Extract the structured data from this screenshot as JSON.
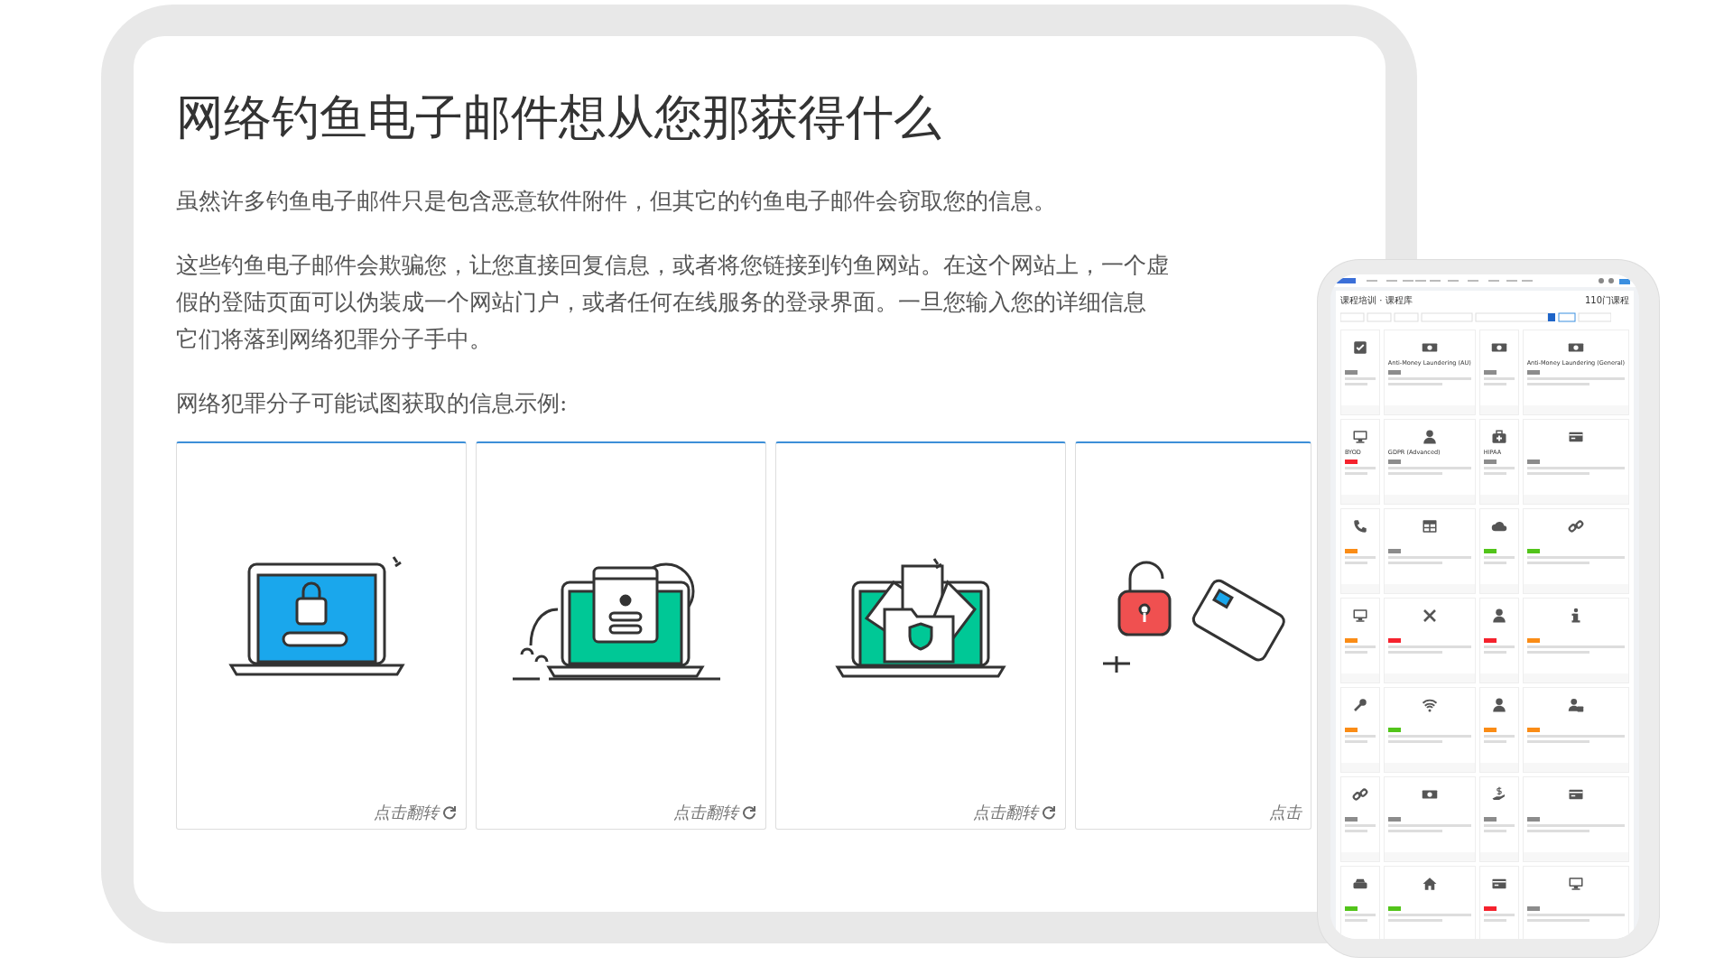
{
  "article": {
    "title": "网络钓鱼电子邮件想从您那获得什么",
    "intro": "虽然许多钓鱼电子邮件只是包含恶意软件附件，但其它的钓鱼电子邮件会窃取您的信息。",
    "body_lines": [
      "这些钓鱼电子邮件会欺骗您，让您直接回复信息，或者将您链接到钓鱼网站。在这个网站上，一个虚",
      "假的登陆页面可以伪装成一个网站门户，或者任何在线服务的登录界面。一旦您输入您的详细信息",
      "它们将落到网络犯罪分子手中。"
    ],
    "list_intro": "网络犯罪分子可能试图获取的信息示例:",
    "cards": [
      {
        "flip_label": "点击翻转"
      },
      {
        "flip_label": "点击翻转"
      },
      {
        "flip_label": "点击翻转"
      },
      {
        "flip_label": "点击"
      }
    ]
  },
  "phone": {
    "page_title": "课程培训 · 课程库",
    "course_count": "110门课程",
    "courses": [
      {
        "color": "#8c8c8c"
      },
      {
        "title": "Anti-Money Laundering (AU)",
        "color": "#8c8c8c"
      },
      {
        "color": "#8c8c8c"
      },
      {
        "title": "Anti-Money Laundering (General)",
        "color": "#8c8c8c"
      },
      {
        "title": "BYOD",
        "color": "#f5222d"
      },
      {
        "title": "GDPR (Advanced)",
        "color": "#8c8c8c"
      },
      {
        "title": "HIPAA",
        "color": "#8c8c8c"
      },
      {
        "color": "#8c8c8c"
      },
      {
        "color": "#fa8c16"
      },
      {
        "color": "#8c8c8c"
      },
      {
        "color": "#52c41a"
      },
      {
        "color": "#52c41a"
      },
      {
        "color": "#fa8c16"
      },
      {
        "color": "#f5222d"
      },
      {
        "color": "#f5222d"
      },
      {
        "color": "#fa8c16"
      },
      {
        "color": "#fa8c16"
      },
      {
        "color": "#52c41a"
      },
      {
        "color": "#fa8c16"
      },
      {
        "color": "#fa8c16"
      },
      {
        "color": "#8c8c8c"
      },
      {
        "color": "#8c8c8c"
      },
      {
        "color": "#8c8c8c"
      },
      {
        "color": "#8c8c8c"
      },
      {
        "color": "#52c41a"
      },
      {
        "color": "#52c41a"
      },
      {
        "color": "#f5222d"
      },
      {
        "color": "#8c8c8c"
      }
    ]
  }
}
